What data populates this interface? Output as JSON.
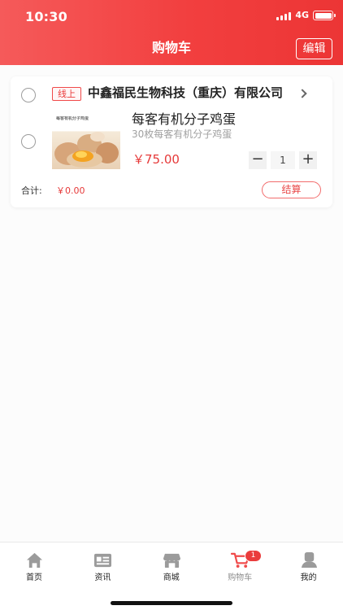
{
  "status_bar": {
    "time": "10:30",
    "network": "4G"
  },
  "header": {
    "title": "购物车",
    "edit_label": "编辑"
  },
  "cart": {
    "store": {
      "tag": "线上",
      "name": "中鑫福民生物科技（重庆）有限公司"
    },
    "item": {
      "image_label": "每客有机分子鸡蛋",
      "title": "每客有机分子鸡蛋",
      "spec": "30枚每客有机分子鸡蛋",
      "price": "￥75.00",
      "quantity": "1",
      "minus_label": "−",
      "plus_label": "+"
    },
    "total_label": "合计:",
    "total_value": "￥0.00",
    "checkout_label": "结算"
  },
  "tabbar": {
    "items": [
      {
        "label": "首页",
        "icon": "home-icon"
      },
      {
        "label": "资讯",
        "icon": "news-icon"
      },
      {
        "label": "商城",
        "icon": "store-icon"
      },
      {
        "label": "购物车",
        "icon": "cart-icon",
        "badge": "1"
      },
      {
        "label": "我的",
        "icon": "profile-icon"
      }
    ]
  },
  "colors": {
    "accent": "#f23f3f",
    "price": "#e63a3a",
    "text": "#222222",
    "muted": "#a0a0a0"
  }
}
